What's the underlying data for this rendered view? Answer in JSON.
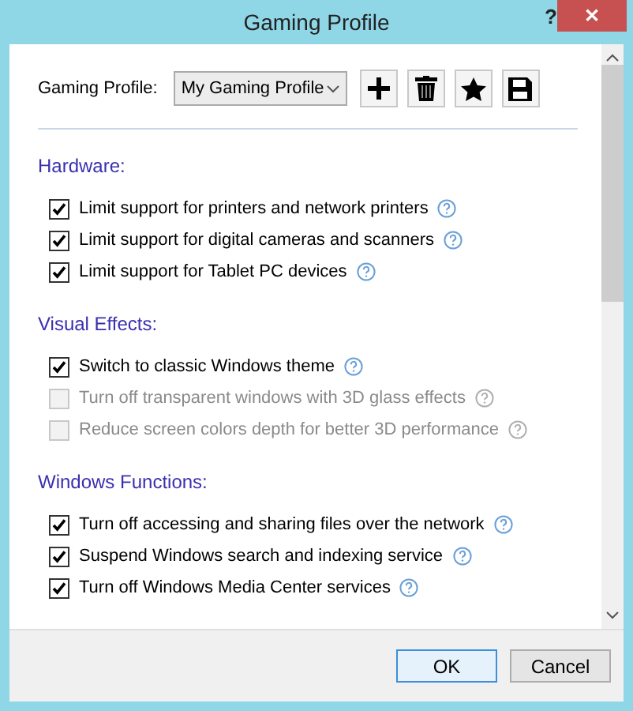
{
  "window": {
    "title": "Gaming Profile",
    "help": "?",
    "close": "✕"
  },
  "profile": {
    "label": "Gaming Profile:",
    "value": "My Gaming Profile"
  },
  "sections": [
    {
      "heading": "Hardware:",
      "options": [
        {
          "label": "Limit support for printers and network printers",
          "checked": true,
          "disabled": false
        },
        {
          "label": "Limit support for digital cameras and scanners",
          "checked": true,
          "disabled": false
        },
        {
          "label": "Limit support for Tablet PC devices",
          "checked": true,
          "disabled": false
        }
      ]
    },
    {
      "heading": "Visual Effects:",
      "options": [
        {
          "label": "Switch to classic Windows theme",
          "checked": true,
          "disabled": false
        },
        {
          "label": "Turn off transparent windows with 3D glass effects",
          "checked": false,
          "disabled": true
        },
        {
          "label": "Reduce screen colors depth for better 3D performance",
          "checked": false,
          "disabled": true
        }
      ]
    },
    {
      "heading": "Windows Functions:",
      "options": [
        {
          "label": "Turn off accessing and sharing files over the network",
          "checked": true,
          "disabled": false
        },
        {
          "label": "Suspend Windows search and indexing service",
          "checked": true,
          "disabled": false
        },
        {
          "label": "Turn off Windows Media Center services",
          "checked": true,
          "disabled": false
        }
      ]
    }
  ],
  "buttons": [
    {
      "label": "OK",
      "kind": "default"
    },
    {
      "label": "Cancel",
      "kind": "normal"
    }
  ]
}
